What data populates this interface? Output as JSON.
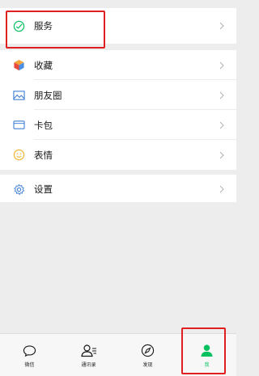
{
  "menu": {
    "services_label": "服务",
    "favorites_label": "收藏",
    "moments_label": "朋友圈",
    "cards_label": "卡包",
    "stickers_label": "表情",
    "settings_label": "设置"
  },
  "tabbar": {
    "chats": "微信",
    "contacts": "通讯录",
    "discover": "发现",
    "me": "我"
  },
  "colors": {
    "accent": "#07c160",
    "highlight": "#e02020"
  }
}
